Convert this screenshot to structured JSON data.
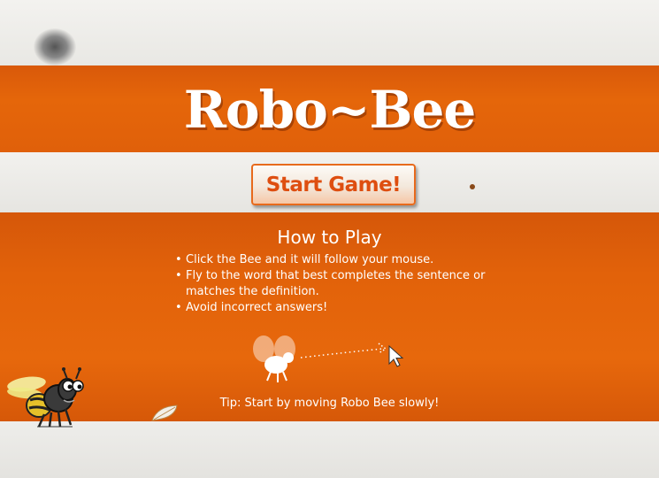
{
  "game": {
    "title": "Robo~Bee",
    "start_button_label": "Start Game!",
    "how_to_play": {
      "heading": "How to Play",
      "rules": [
        "Click the Bee and it will follow your mouse.",
        "Fly to the word that best completes the sentence or matches the definition.",
        "Avoid incorrect answers!"
      ]
    },
    "tip": "Tip: Start by moving Robo Bee slowly!"
  },
  "colors": {
    "plank_orange": "#e2620a",
    "board_white": "#eeedea",
    "button_text": "#de4e10",
    "text_white": "#ffffff"
  },
  "icons": [
    "robo-bee-icon",
    "demo-bee-icon",
    "mouse-pointer-icon",
    "leaf-icon"
  ]
}
